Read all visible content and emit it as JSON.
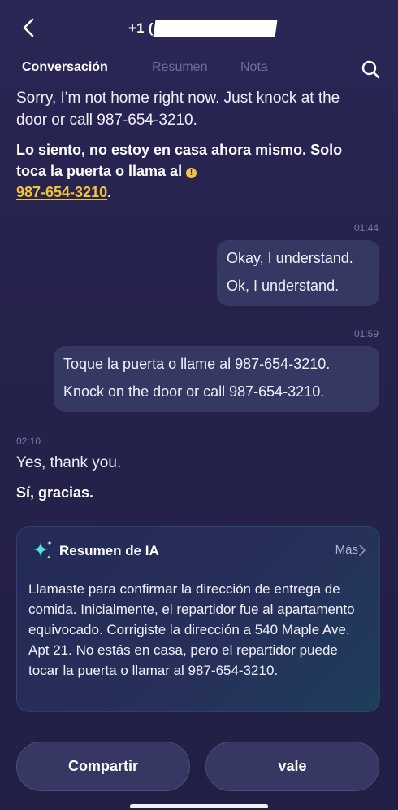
{
  "header": {
    "back_icon": "chevron-left-icon",
    "title_visible": "+1 (",
    "search_icon": "search-icon"
  },
  "tabs": [
    {
      "label": "Conversación",
      "active": true
    },
    {
      "label": "Resumen",
      "active": false
    },
    {
      "label": "Nota",
      "active": false
    }
  ],
  "messages": {
    "m1_en": "Sorry, I'm not home right now. Just knock at the door or call 987-654-3210.",
    "m1_es_text": "Lo siento, no estoy en casa ahora mismo. Solo toca la puerta o llama al",
    "m1_es_phone": "987-654-3210",
    "m1_es_end": ".",
    "t2": "01:44",
    "m2_line1": "Okay, I understand.",
    "m2_line2": "Ok, I understand.",
    "t3": "01:59",
    "m3_line1": "Toque la puerta o llame al 987-654-3210.",
    "m3_line2": "Knock on the door or call 987-654-3210.",
    "t4": "02:10",
    "m4_en": "Yes, thank you.",
    "m4_es": "Sí, gracias."
  },
  "summary": {
    "icon": "sparkle-icon",
    "title": "Resumen de IA",
    "more": "Más",
    "body": "Llamaste para confirmar la dirección de entrega de comida. Inicialmente, el repartidor fue al apartamento equivocado. Corrigiste la dirección a 540 Maple Ave. Apt 21. No estás en casa, pero el repartidor puede tocar la puerta o llamar al 987-654-3210."
  },
  "actions": {
    "share": "Compartir",
    "ok": "vale"
  },
  "colors": {
    "background": "#25224c",
    "accent_link": "#f2c23e",
    "bubble": "#343863",
    "tab_inactive": "#6f6ca2"
  }
}
